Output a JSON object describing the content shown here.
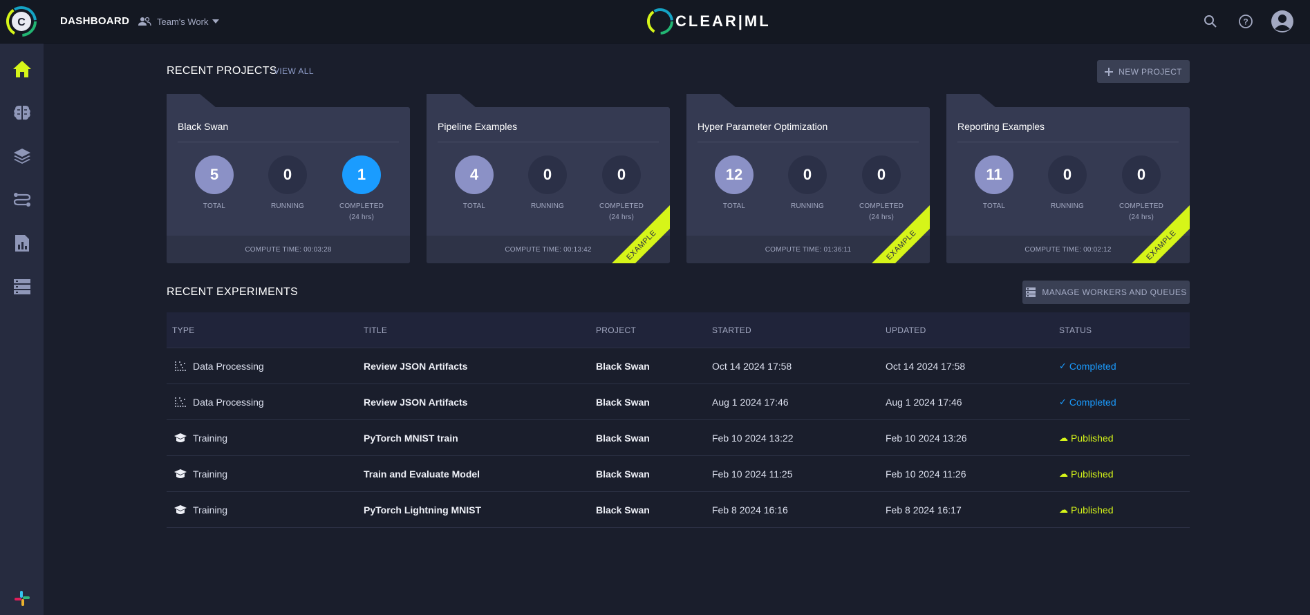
{
  "header": {
    "title": "DASHBOARD",
    "team": "Team's Work",
    "logo_text": "CLEAR|ML"
  },
  "colors": {
    "accent": "#d6f519",
    "completed": "#1a9cff",
    "published": "#d6f519",
    "total_circle": "#8b91c6",
    "zero_circle": "#2b3047"
  },
  "sidebar": {
    "items": [
      {
        "icon": "home-icon",
        "active": true
      },
      {
        "icon": "brain-icon",
        "active": false
      },
      {
        "icon": "layers-icon",
        "active": false
      },
      {
        "icon": "pipelines-icon",
        "active": false
      },
      {
        "icon": "reports-icon",
        "active": false
      },
      {
        "icon": "workers-icon",
        "active": false
      }
    ],
    "bottom_icon": "slack-icon"
  },
  "projects": {
    "title": "RECENT PROJECTS",
    "view_all": "VIEW ALL",
    "new_button": "NEW PROJECT",
    "cards": [
      {
        "name": "Black Swan",
        "total": "5",
        "running": "0",
        "completed": "1",
        "compute": "COMPUTE TIME: 00:03:28",
        "example": false
      },
      {
        "name": "Pipeline Examples",
        "total": "4",
        "running": "0",
        "completed": "0",
        "compute": "COMPUTE TIME: 00:13:42",
        "example": true
      },
      {
        "name": "Hyper Parameter Optimization",
        "total": "12",
        "running": "0",
        "completed": "0",
        "compute": "COMPUTE TIME: 01:36:11",
        "example": true
      },
      {
        "name": "Reporting Examples",
        "total": "11",
        "running": "0",
        "completed": "0",
        "compute": "COMPUTE TIME: 00:02:12",
        "example": true
      }
    ],
    "labels": {
      "total": "TOTAL",
      "running": "RUNNING",
      "completed": "COMPLETED",
      "completed_sub": "(24 hrs)",
      "example": "EXAMPLE"
    }
  },
  "experiments": {
    "title": "RECENT EXPERIMENTS",
    "manage_button": "MANAGE WORKERS AND QUEUES",
    "columns": [
      "TYPE",
      "TITLE",
      "PROJECT",
      "STARTED",
      "UPDATED",
      "STATUS"
    ],
    "rows": [
      {
        "type": "Data Processing",
        "type_icon": "data-processing-icon",
        "title": "Review JSON Artifacts",
        "project": "Black Swan",
        "started": "Oct 14 2024 17:58",
        "updated": "Oct 14 2024 17:58",
        "status": "Completed"
      },
      {
        "type": "Data Processing",
        "type_icon": "data-processing-icon",
        "title": "Review JSON Artifacts",
        "project": "Black Swan",
        "started": "Aug 1 2024 17:46",
        "updated": "Aug 1 2024 17:46",
        "status": "Completed"
      },
      {
        "type": "Training",
        "type_icon": "training-icon",
        "title": "PyTorch MNIST train",
        "project": "Black Swan",
        "started": "Feb 10 2024 13:22",
        "updated": "Feb 10 2024 13:26",
        "status": "Published"
      },
      {
        "type": "Training",
        "type_icon": "training-icon",
        "title": "Train and Evaluate Model",
        "project": "Black Swan",
        "started": "Feb 10 2024 11:25",
        "updated": "Feb 10 2024 11:26",
        "status": "Published"
      },
      {
        "type": "Training",
        "type_icon": "training-icon",
        "title": "PyTorch Lightning MNIST",
        "project": "Black Swan",
        "started": "Feb 8 2024 16:16",
        "updated": "Feb 8 2024 16:17",
        "status": "Published"
      }
    ]
  }
}
